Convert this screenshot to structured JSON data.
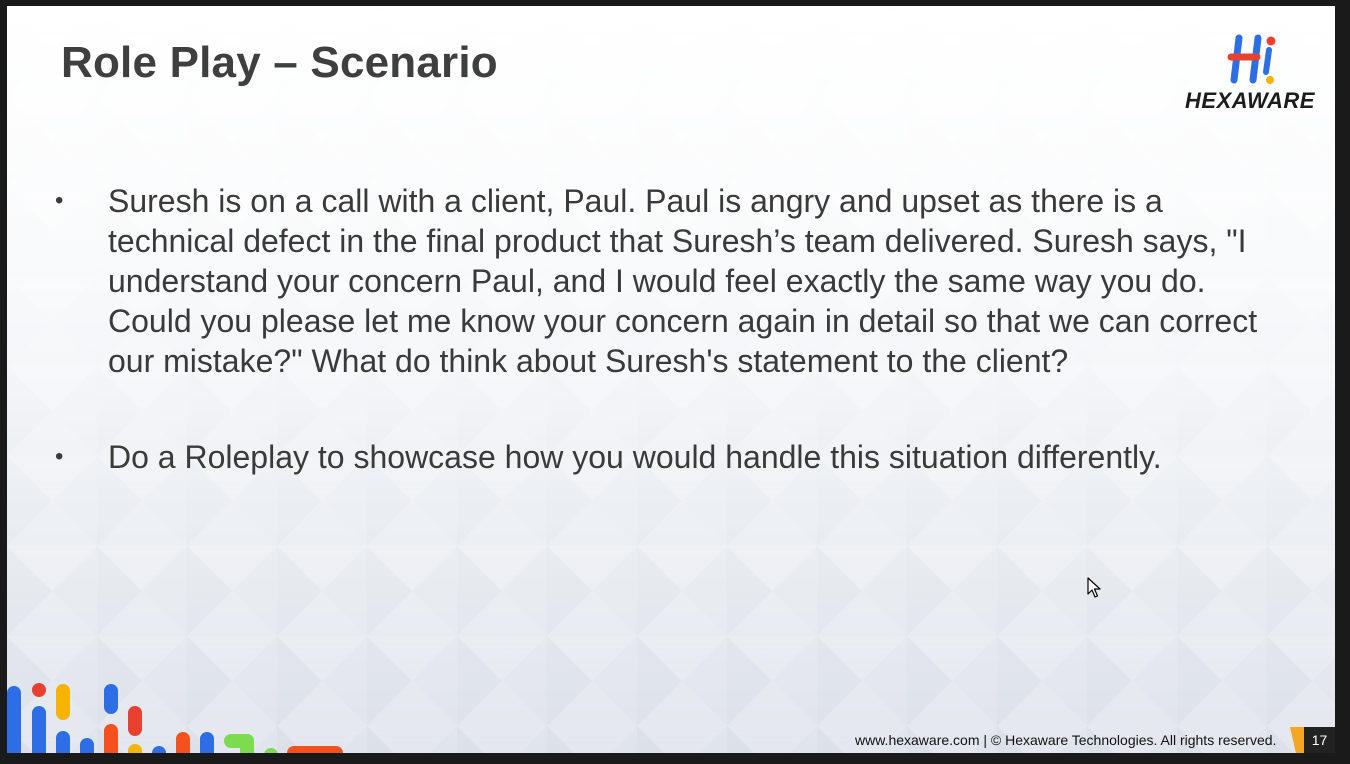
{
  "slide": {
    "title": "Role Play – Scenario",
    "bullets": [
      "Suresh is on a call with a client, Paul. Paul is angry and upset as there is a technical defect in the final product that Suresh’s team delivered. Suresh says, \"I understand your concern Paul, and I would feel exactly the same way you do. Could you please let me know your concern again in detail so that we can correct our mistake?\" What do think about Suresh's statement to the client?",
      "Do a Roleplay to showcase how you would handle this situation differently."
    ],
    "bullet_symbol": "•",
    "footer": "www.hexaware.com  | © Hexaware Technologies. All rights reserved.",
    "page_number": "17"
  },
  "logo": {
    "text": "HEXAWARE",
    "colors": {
      "blue": "#2d6ee6",
      "red": "#e8412f",
      "yellow": "#f6b400"
    }
  },
  "decor_colors": [
    "#2d6ee6",
    "#e8412f",
    "#f6b400",
    "#7bdc4f",
    "#f4511e"
  ],
  "icons": {
    "pointer": "mouse-pointer-icon"
  }
}
